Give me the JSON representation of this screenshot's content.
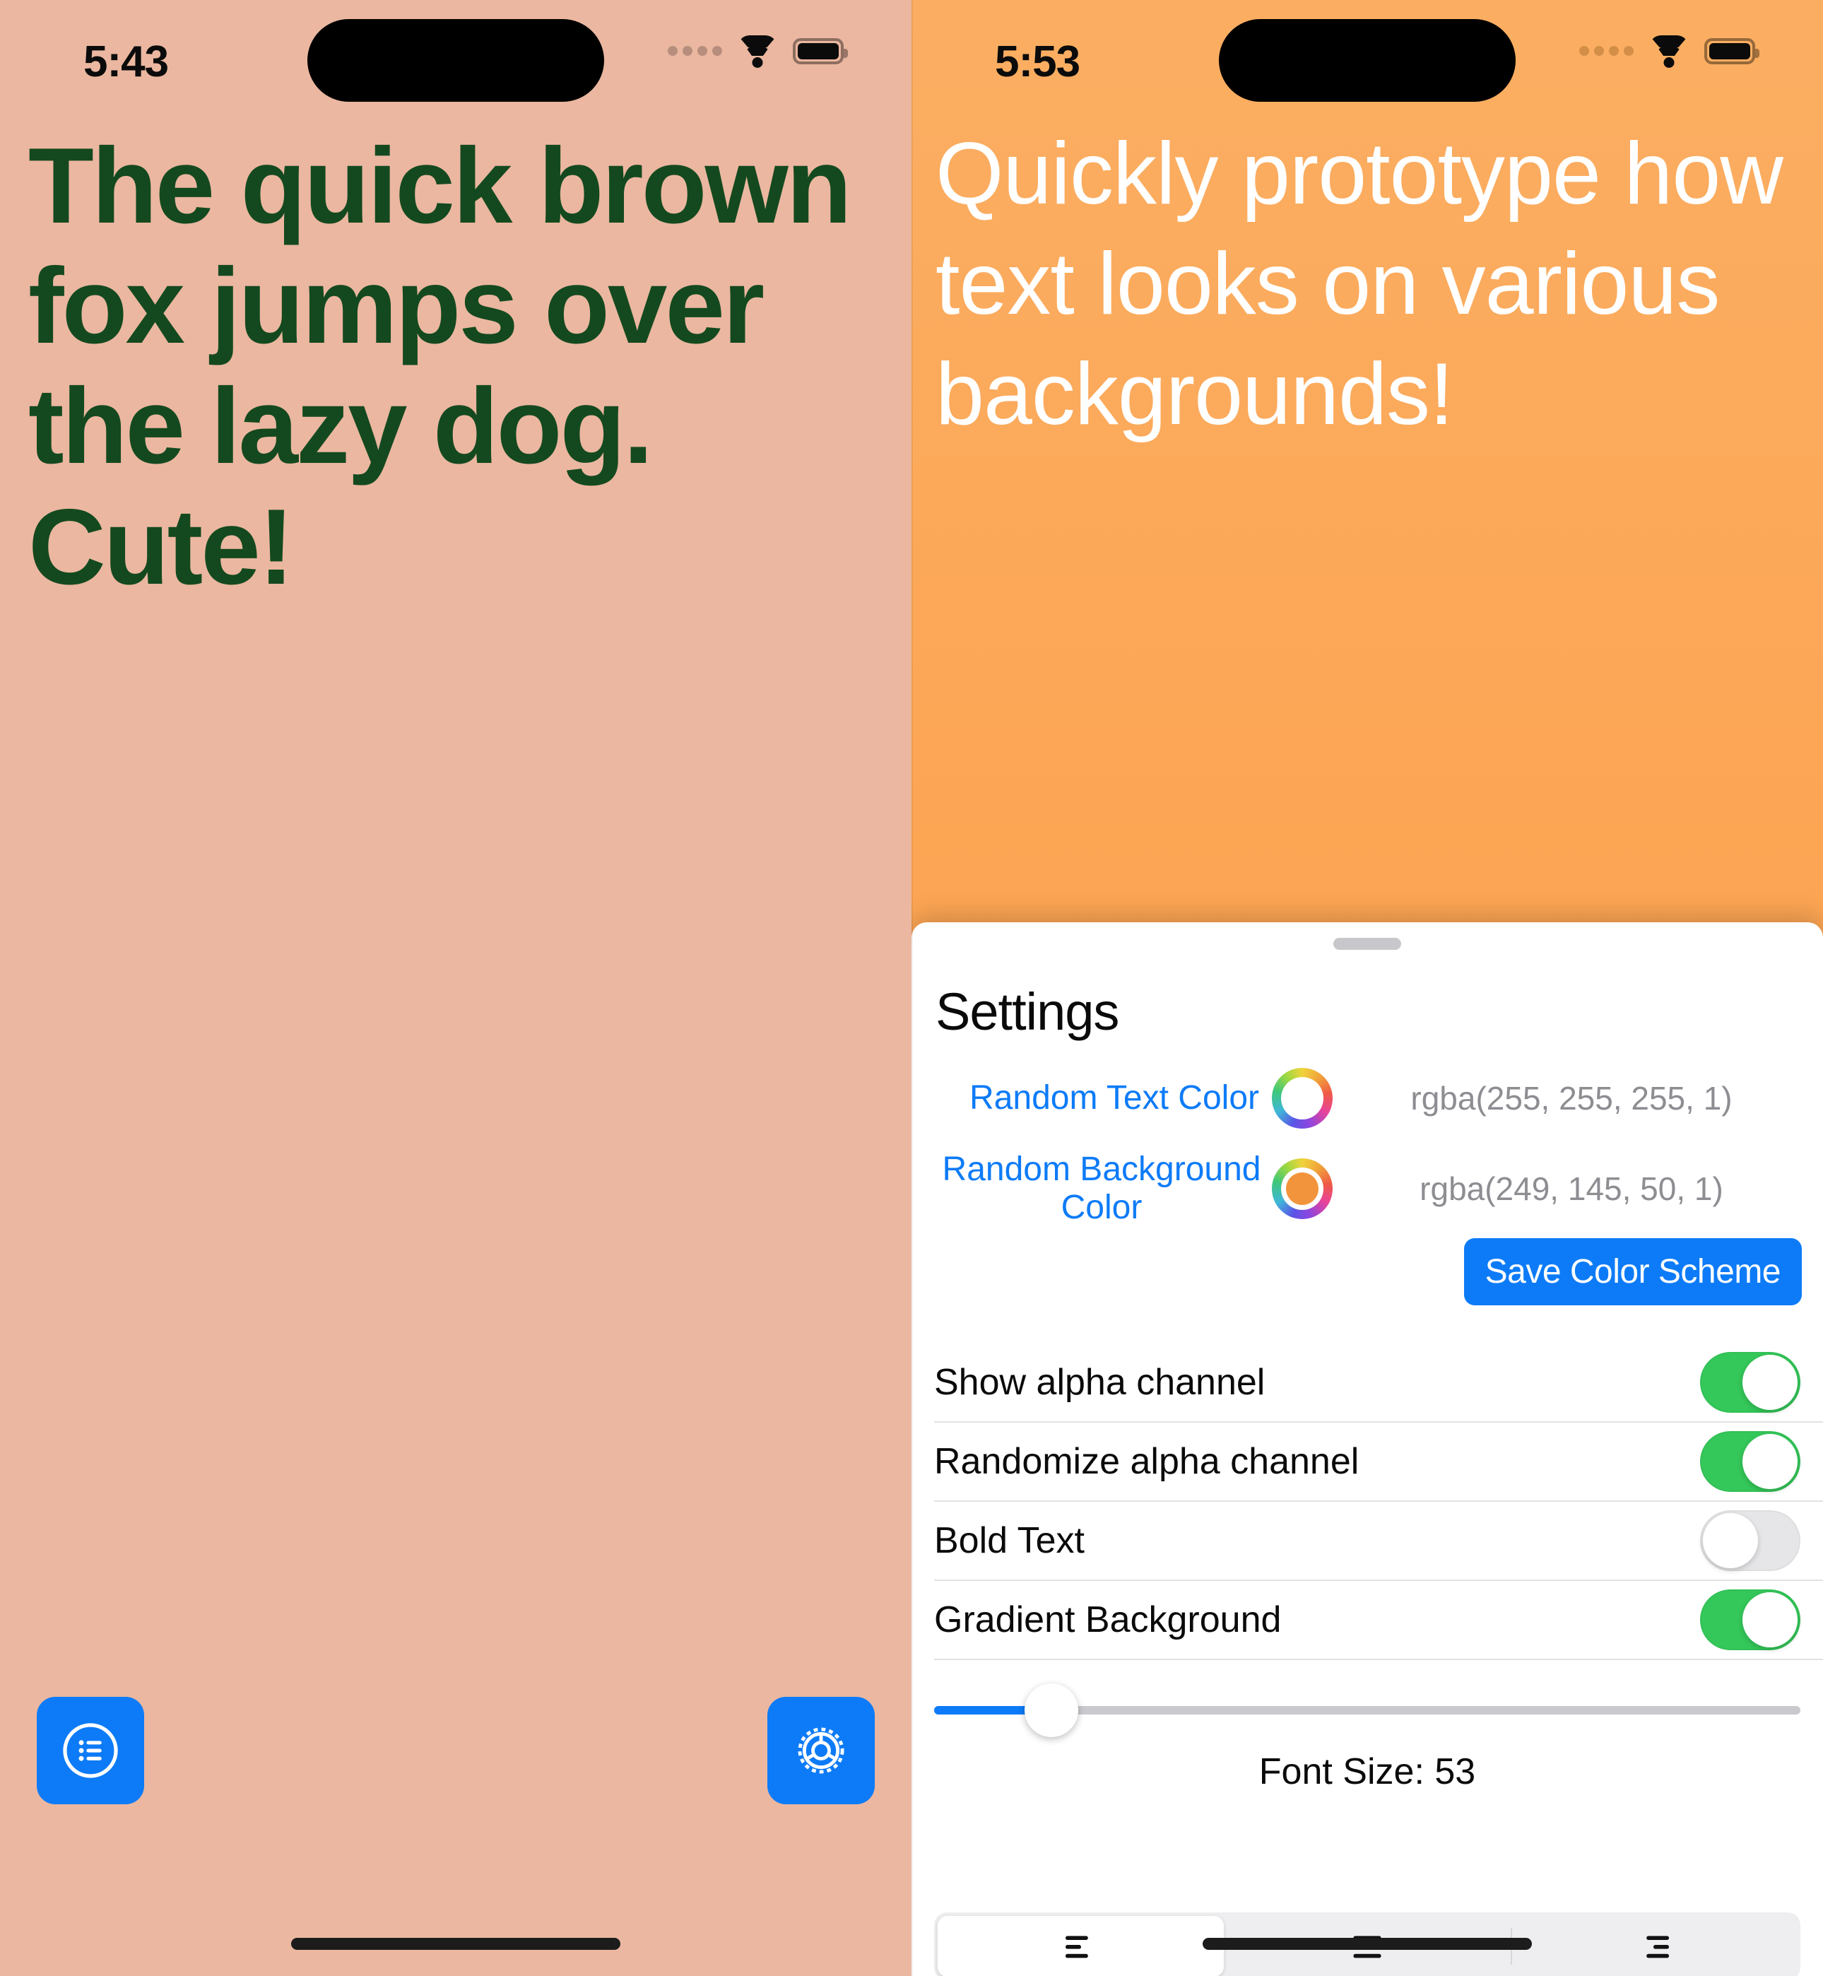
{
  "left_phone": {
    "status_bar": {
      "time": "5:43",
      "signal_icon": "signal-dots-icon",
      "wifi_icon": "wifi-icon",
      "battery_icon": "battery-icon"
    },
    "sample_text": "The quick brown fox jumps over the lazy dog. Cute!",
    "text_color": "#14491f",
    "background_color": "#ebb7a0",
    "buttons": [
      {
        "name": "list-button",
        "icon": "list-bullet-circle-icon",
        "color": "#0d7bf7"
      },
      {
        "name": "settings-button",
        "icon": "gear-icon",
        "color": "#0d7bf7"
      }
    ]
  },
  "right_phone": {
    "status_bar": {
      "time": "5:53",
      "signal_icon": "signal-dots-icon",
      "wifi_icon": "wifi-icon",
      "battery_icon": "battery-icon"
    },
    "sample_text": "Quickly prototype how text looks on various backgrounds!",
    "text_color": "#ffffff",
    "background_gradient_from": "#fbae62",
    "background_gradient_to": "#fd9a42",
    "settings_sheet": {
      "title": "Settings",
      "grabber": "drag-handle",
      "color_rows": [
        {
          "label": "Random Text Color",
          "swatch": "#ffffff",
          "value": "rgba(255, 255, 255, 1)"
        },
        {
          "label": "Random Background Color",
          "swatch": "#f2943b",
          "value": "rgba(249, 145, 50, 1)"
        }
      ],
      "save_button": "Save Color Scheme",
      "toggles": [
        {
          "label": "Show alpha channel",
          "on": true
        },
        {
          "label": "Randomize alpha channel",
          "on": true
        },
        {
          "label": "Bold Text",
          "on": false
        },
        {
          "label": "Gradient Background",
          "on": true
        }
      ],
      "slider": {
        "value": 53,
        "min": 10,
        "max": 330,
        "percent": 13.5
      },
      "font_size_label": "Font Size: 53",
      "alignment_segments": [
        {
          "icon": "text-align-left-icon",
          "selected": true
        },
        {
          "icon": "text-align-center-icon",
          "selected": false
        },
        {
          "icon": "text-align-right-icon",
          "selected": false
        }
      ]
    }
  },
  "accent_color": "#0d7bf7",
  "toggle_on_color": "#34c759"
}
